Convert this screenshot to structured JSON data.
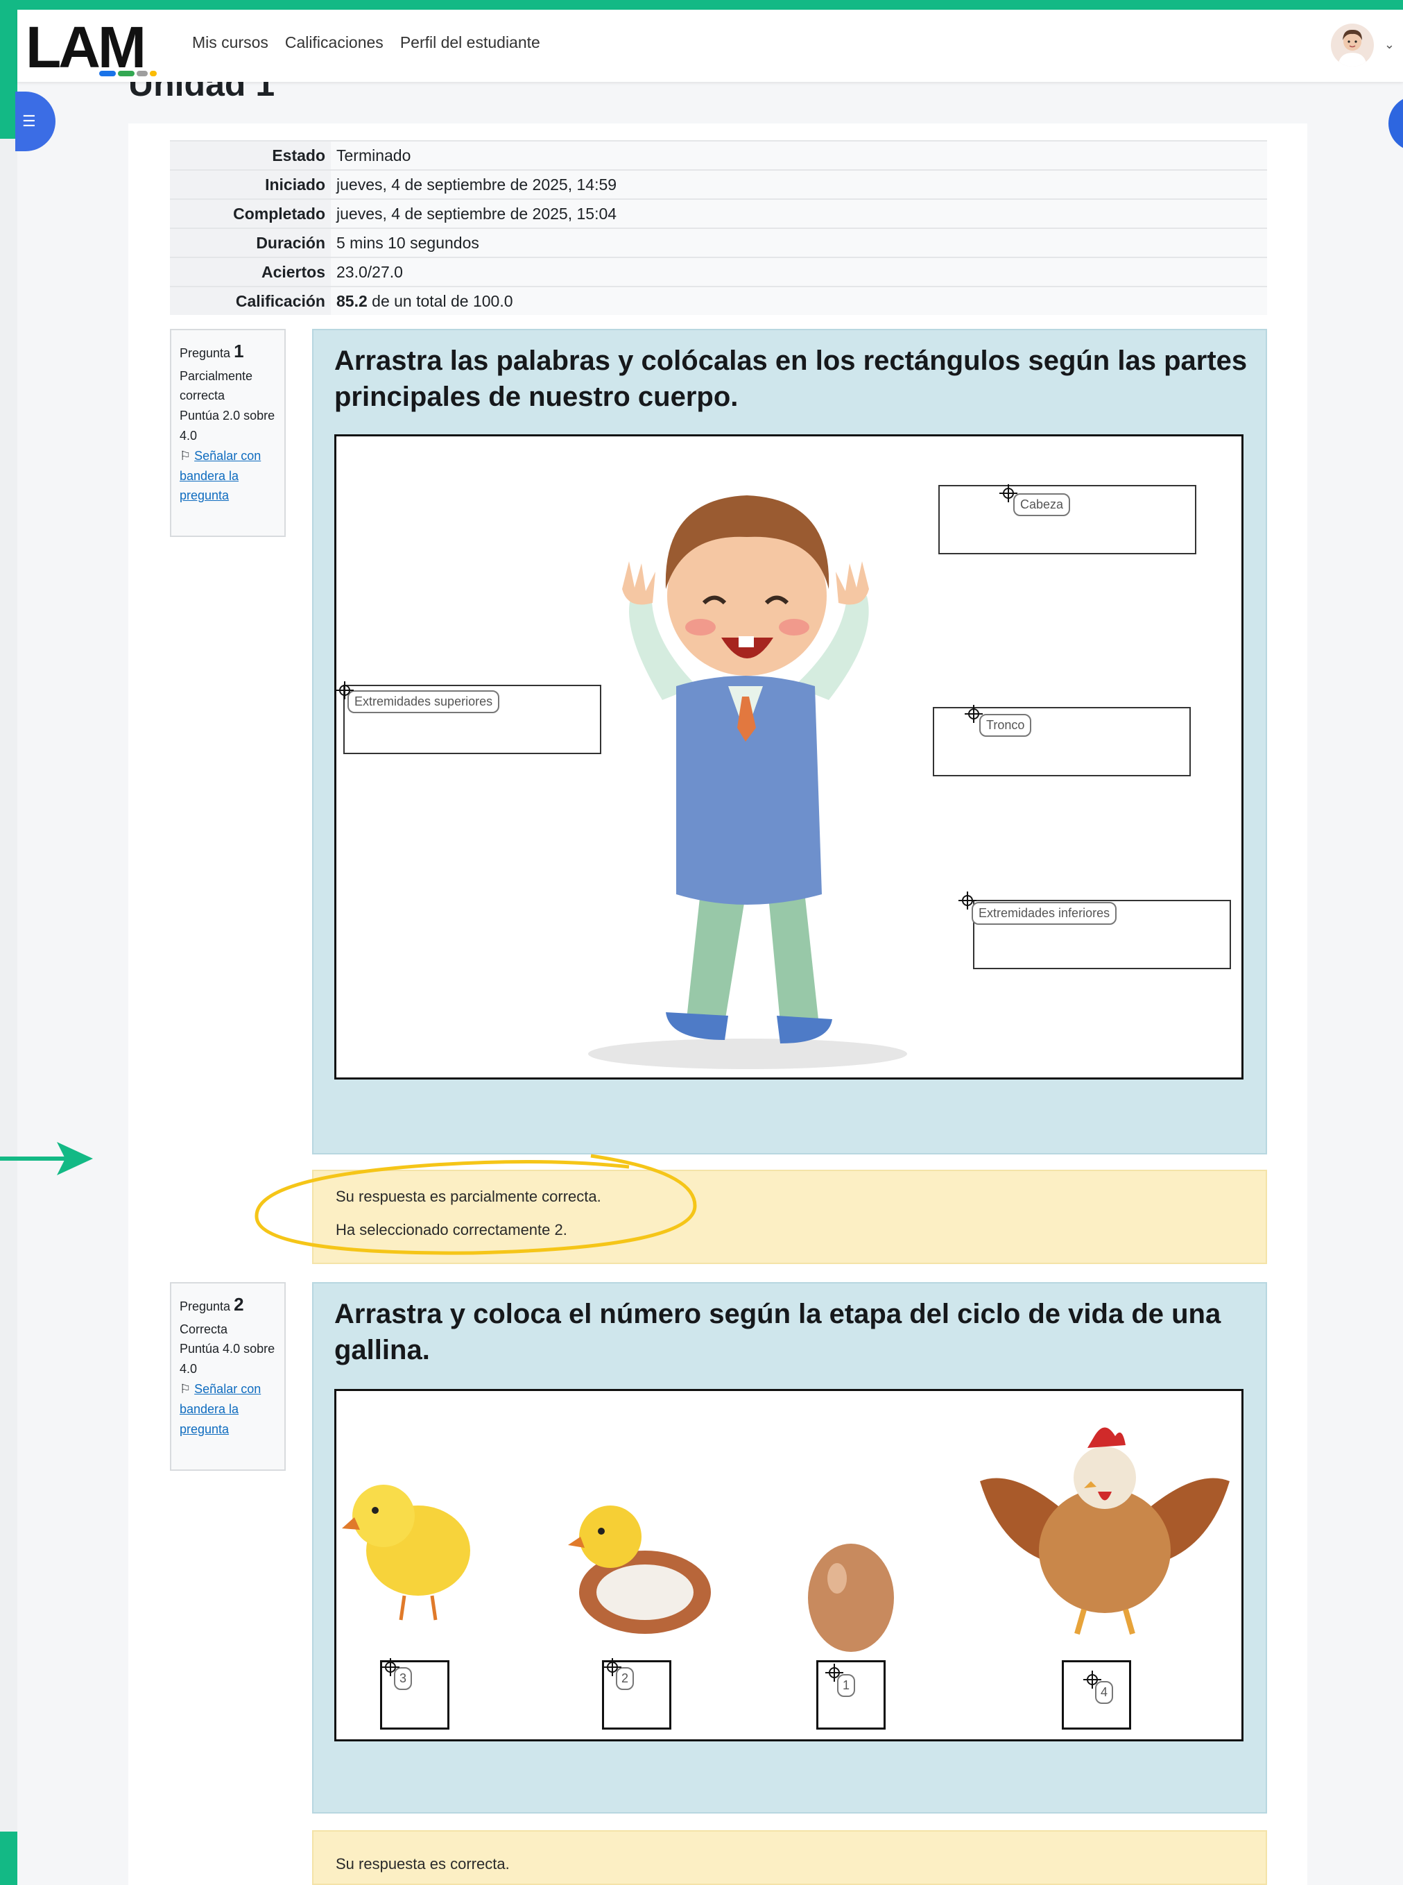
{
  "logo": {
    "text": "LAM",
    "dot_colors": [
      "#1a73e8",
      "#34a853",
      "#9e9e9e",
      "#fbbc04"
    ]
  },
  "nav": {
    "links": [
      "Mis cursos",
      "Calificaciones",
      "Perfil del estudiante"
    ]
  },
  "page": {
    "section_title": "Unidad 1"
  },
  "summary": [
    {
      "label": "Estado",
      "value": "Terminado"
    },
    {
      "label": "Iniciado",
      "value": "jueves, 4 de septiembre de 2025, 14:59"
    },
    {
      "label": "Completado",
      "value": "jueves, 4 de septiembre de 2025, 15:04"
    },
    {
      "label": "Duración",
      "value": "5 mins 10 segundos"
    },
    {
      "label": "Aciertos",
      "value": "23.0/27.0"
    },
    {
      "label": "Calificación",
      "value_bold": "85.2",
      "value_rest": " de un total de 100.0"
    }
  ],
  "q1": {
    "label": "Pregunta",
    "number": "1",
    "status": "Parcialmente correcta",
    "score": "Puntúa 2.0 sobre 4.0",
    "flag_link": "Señalar con bandera la pregunta",
    "title": "Arrastra las palabras y colócalas en los rectángulos según las partes principales de nuestro cuerpo.",
    "chips": [
      "Cabeza",
      "Extremidades superiores",
      "Tronco",
      "Extremidades inferiores"
    ],
    "feedback_1": "Su respuesta es parcialmente correcta.",
    "feedback_2": "Ha seleccionado correctamente 2."
  },
  "q2": {
    "label": "Pregunta",
    "number": "2",
    "status": "Correcta",
    "score": "Puntúa 4.0 sobre 4.0",
    "flag_link": "Señalar con bandera la pregunta",
    "title": "Arrastra y coloca  el número según la etapa del ciclo de vida de una gallina.",
    "numbers": [
      "3",
      "2",
      "1",
      "4"
    ],
    "feedback_1": "Su respuesta es correcta."
  },
  "colors": {
    "accent_green": "#13b985",
    "question_bg": "#cfe6ec",
    "feedback_bg": "#fcefc4",
    "annotation_yellow": "#f5c518"
  }
}
